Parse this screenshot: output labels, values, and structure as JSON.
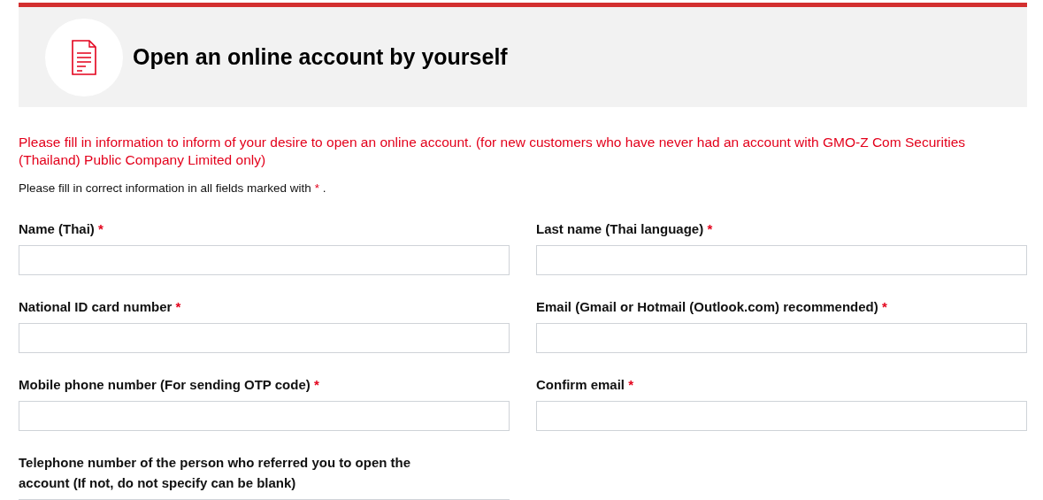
{
  "header": {
    "title": "Open an online account by yourself"
  },
  "intro": "Please fill in information to inform of your desire to open an online account. (for new customers who have never had an account with GMO-Z Com Securities (Thailand) Public Company Limited only)",
  "note": {
    "text": "Please fill in correct information in all fields marked with",
    "mark": "*",
    "end": "."
  },
  "fields": [
    {
      "label": "Name (Thai)",
      "required": true,
      "required_mark": "*"
    },
    {
      "label": "Last name (Thai language)",
      "required": true,
      "required_mark": "*"
    },
    {
      "label": "National ID card number",
      "required": true,
      "required_mark": "*"
    },
    {
      "label": "Email (Gmail or Hotmail (Outlook.com) recommended)",
      "required": true,
      "required_mark": "*"
    },
    {
      "label": "Mobile phone number (For sending OTP code)",
      "required": true,
      "required_mark": "*"
    },
    {
      "label": "Confirm email",
      "required": true,
      "required_mark": "*"
    },
    {
      "label": "Telephone number of the person who referred you to open the account (If not, do not specify can be blank)",
      "required": false
    }
  ]
}
